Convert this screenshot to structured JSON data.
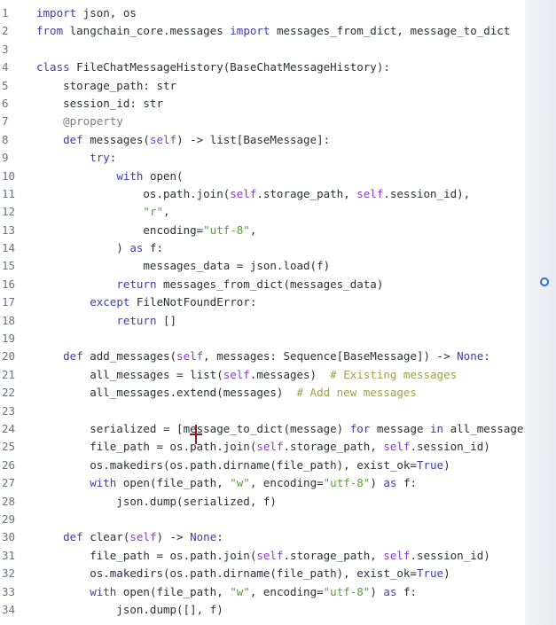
{
  "editor": {
    "line_numbers": [
      "1",
      "2",
      "3",
      "4",
      "5",
      "6",
      "7",
      "8",
      "9",
      "10",
      "11",
      "12",
      "13",
      "14",
      "15",
      "16",
      "17",
      "18",
      "19",
      "20",
      "21",
      "22",
      "23",
      "24",
      "25",
      "26",
      "27",
      "28",
      "29",
      "30",
      "31",
      "32",
      "33",
      "34"
    ],
    "lines": [
      "import json, os",
      "from langchain_core.messages import messages_from_dict, message_to_dict",
      "",
      "class FileChatMessageHistory(BaseChatMessageHistory):",
      "    storage_path: str",
      "    session_id: str",
      "    @property",
      "    def messages(self) -> list[BaseMessage]:",
      "        try:",
      "            with open(",
      "                os.path.join(self.storage_path, self.session_id),",
      "                \"r\",",
      "                encoding=\"utf-8\",",
      "            ) as f:",
      "                messages_data = json.load(f)",
      "            return messages_from_dict(messages_data)",
      "        except FileNotFoundError:",
      "            return []",
      "",
      "    def add_messages(self, messages: Sequence[BaseMessage]) -> None:",
      "        all_messages = list(self.messages)  # Existing messages",
      "        all_messages.extend(messages)  # Add new messages",
      "",
      "        serialized = [message_to_dict(message) for message in all_messages]",
      "        file_path = os.path.join(self.storage_path, self.session_id)",
      "        os.makedirs(os.path.dirname(file_path), exist_ok=True)",
      "        with open(file_path, \"w\", encoding=\"utf-8\") as f:",
      "            json.dump(serialized, f)",
      "",
      "    def clear(self) -> None:",
      "        file_path = os.path.join(self.storage_path, self.session_id)",
      "        os.makedirs(os.path.dirname(file_path), exist_ok=True)",
      "        with open(file_path, \"w\", encoding=\"utf-8\") as f:",
      "            json.dump([], f)"
    ]
  },
  "colors": {
    "keyword": "#3e3ea8",
    "string": "#5a9e3a",
    "comment": "#9aa24a",
    "self": "#8a3ad0",
    "scroll_accent": "#2a6be0"
  }
}
